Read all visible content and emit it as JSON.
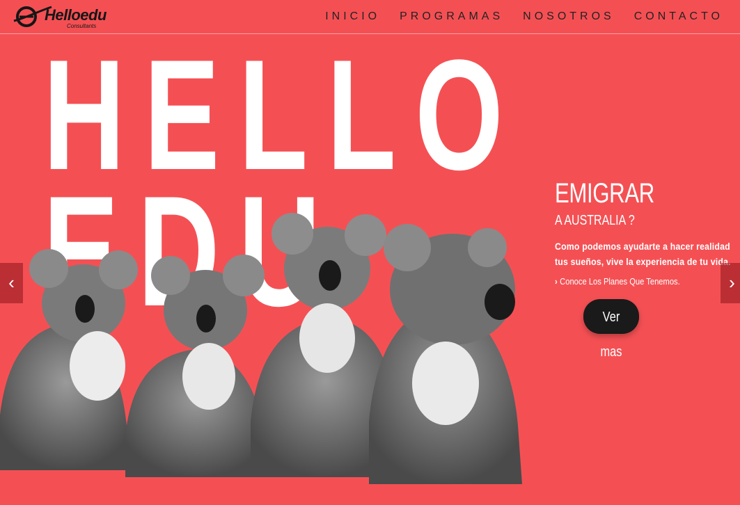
{
  "brand": {
    "name": "Helloedu",
    "tagline": "Consultants"
  },
  "nav": {
    "items": [
      "INICIO",
      "PROGRAMAS",
      "NOSOTROS",
      "CONTACTO"
    ]
  },
  "hero": {
    "line1": "HELLO",
    "line2": "EDU",
    "title": "EMIGRAR",
    "subtitle": "A AUSTRALIA ?",
    "description": "Como podemos ayudarte a hacer realidad tus sueños, vive la experiencia de tu vida.",
    "link_label": "Conoce Los Planes Que Tenemos.",
    "cta_label": "Ver mas"
  },
  "slider": {
    "prev_icon": "‹",
    "next_icon": "›"
  },
  "colors": {
    "background": "#f45054",
    "cta": "#1a1a1a",
    "text": "#ffffff"
  }
}
